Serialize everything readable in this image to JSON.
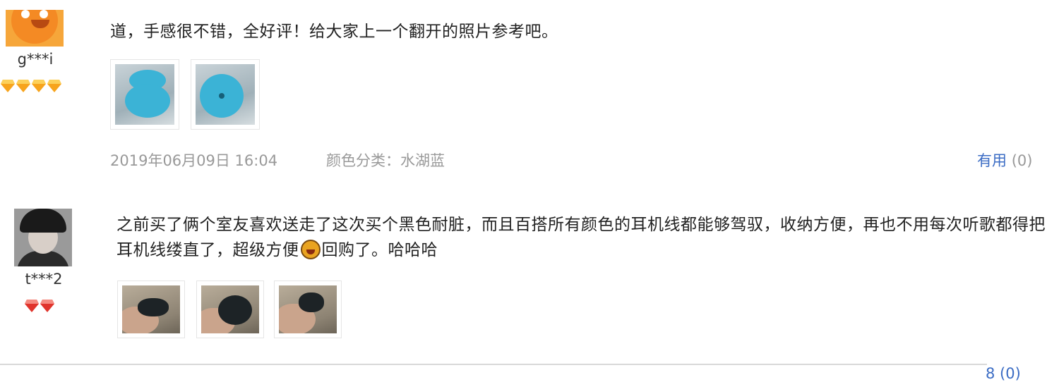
{
  "reviews": [
    {
      "username": "g***i",
      "badge_count": 4,
      "comment": "道，手感很不错，全好评！给大家上一个翻开的照片参考吧。",
      "photo_count": 2,
      "date": "2019年06月09日 16:04",
      "color_label": "颜色分类：",
      "color_value": "水湖蓝",
      "useful_label": "有用",
      "useful_count": "(0)"
    },
    {
      "username": "t***2",
      "badge_count": 2,
      "comment_part1": "之前买了俩个室友喜欢送走了这次买个黑色耐脏，而且百搭所有颜色的耳机线都能够驾驭，收纳方便，再也不用每次听歌都得把耳机线缕直了，超级方便",
      "comment_part2": "回购了。哈哈哈",
      "photo_count": 3,
      "useful_partial": "8 (0)"
    }
  ],
  "colors": {
    "link": "#3b6cc4",
    "meta_text": "#999999",
    "badge_orange": "#f7a41d",
    "badge_red": "#e0342c"
  },
  "icons": {
    "badge_1": "orange-diamond-icon",
    "badge_2": "red-diamond-icon",
    "emoji": "money-face-emoji-icon"
  }
}
